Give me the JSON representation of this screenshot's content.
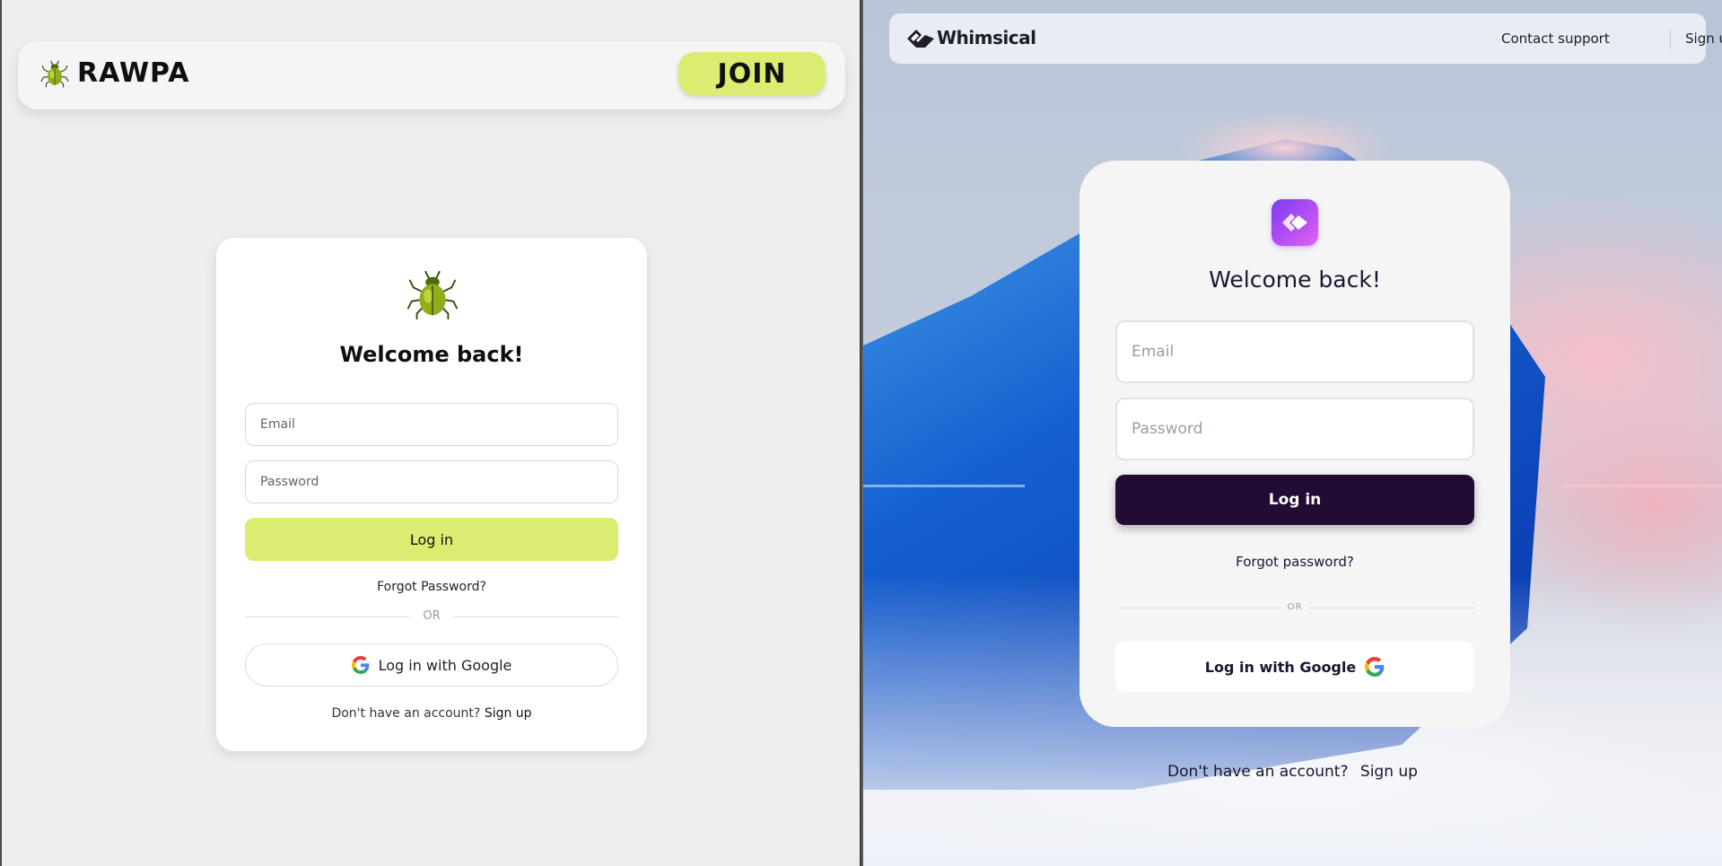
{
  "left_app": {
    "header": {
      "logo_icon": "beetle-icon",
      "brand": "RAWPA",
      "join_label": "JOIN"
    },
    "card": {
      "icon": "beetle-icon",
      "title": "Welcome back!",
      "email_placeholder": "Email",
      "password_placeholder": "Password",
      "login_label": "Log in",
      "forgot_label": "Forgot Password?",
      "or_label": "OR",
      "google_label": "Log in with Google",
      "signup_prompt": "Don't have an account?",
      "signup_label": "Sign up"
    },
    "colors": {
      "accent": "#dcec70",
      "background": "#efeded"
    }
  },
  "right_app": {
    "header": {
      "logo_icon": "whimsical-diamond-icon",
      "brand": "Whimsical",
      "contact_label": "Contact support",
      "signup_label": "Sign up"
    },
    "card": {
      "icon": "whimsical-app-icon",
      "title": "Welcome back!",
      "email_placeholder": "Email",
      "password_placeholder": "Password",
      "login_label": "Log in",
      "forgot_label": "Forgot password?",
      "or_label": "OR",
      "google_label": "Log in with Google"
    },
    "footer": {
      "signup_prompt": "Don't have an account?",
      "signup_label": "Sign up"
    },
    "colors": {
      "primary": "#220c33",
      "app_icon_gradient": [
        "#7b3cf0",
        "#e163f0"
      ]
    }
  }
}
